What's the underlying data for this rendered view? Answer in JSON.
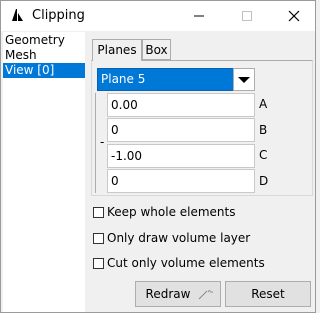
{
  "window": {
    "title": "Clipping"
  },
  "sidebar": {
    "items": [
      "Geometry",
      "Mesh",
      "View [0]"
    ]
  },
  "tabs": [
    "Planes",
    "Box"
  ],
  "plane_select": {
    "value": "Plane 5"
  },
  "fields": [
    {
      "value": "0.00",
      "label": "A"
    },
    {
      "value": "0",
      "label": "B"
    },
    {
      "value": "-1.00",
      "label": "C"
    },
    {
      "value": "0",
      "label": "D"
    }
  ],
  "group_dash": "-",
  "checkboxes": [
    "Keep whole elements",
    "Only draw volume layer",
    "Cut only volume elements"
  ],
  "buttons": {
    "redraw": "Redraw",
    "reset": "Reset"
  },
  "colors": {
    "selection": "#0078d7",
    "window_bg": "#f0f0f0"
  }
}
